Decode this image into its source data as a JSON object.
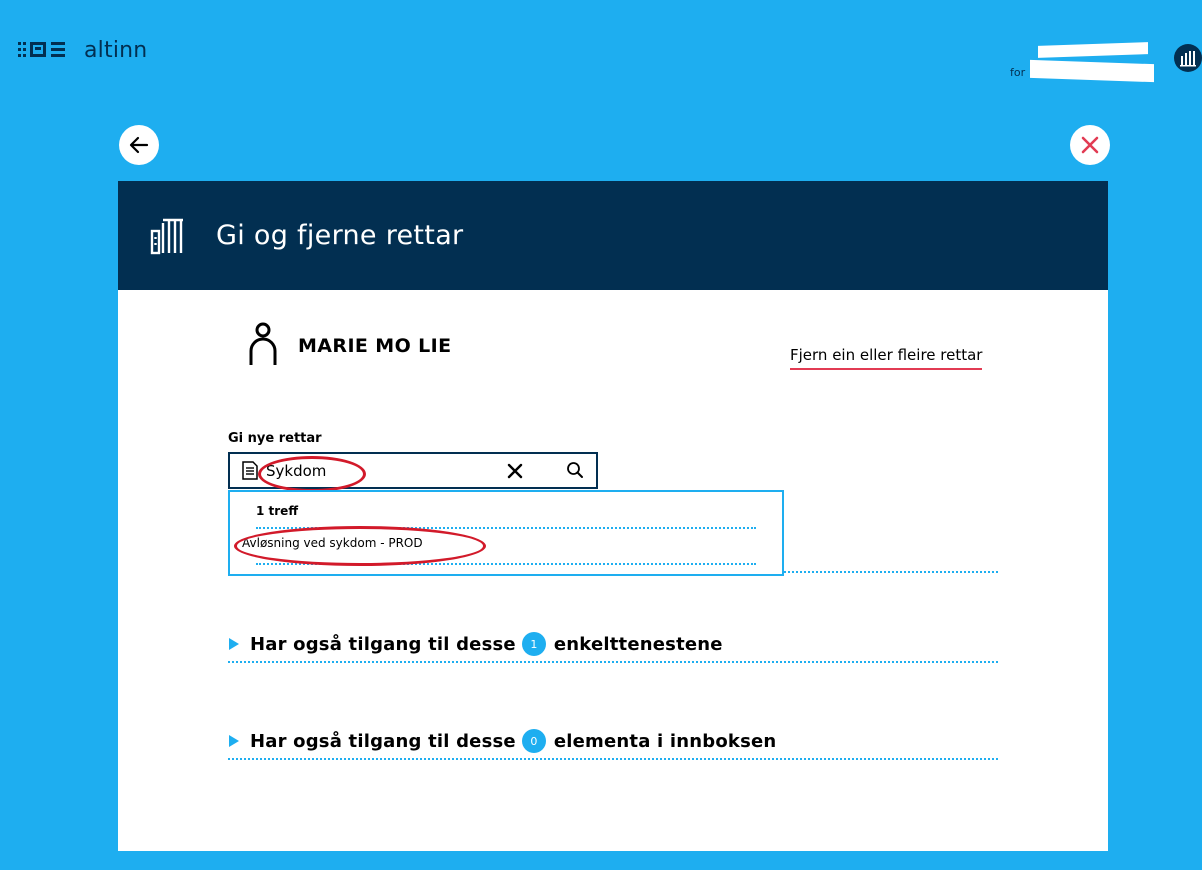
{
  "brand": {
    "logo_text": "altinn"
  },
  "user": {
    "for_label": "for"
  },
  "modal": {
    "title": "Gi og fjerne rettar"
  },
  "person": {
    "name": "MARIE MO LIE",
    "remove_rights_link": "Fjern ein eller fleire rettar"
  },
  "search": {
    "label": "Gi nye rettar",
    "value": "Sykdom",
    "hits_text": "1 treff",
    "results": [
      "Avløsning ved sykdom - PROD"
    ]
  },
  "expanders": [
    {
      "prefix": "Har også tilgang til desse",
      "count": "1",
      "suffix": "enkelttenestene"
    },
    {
      "prefix": "Har også tilgang til desse",
      "count": "0",
      "suffix": "elementa i innboksen"
    }
  ],
  "colors": {
    "background": "#1eaef0",
    "header": "#022f51",
    "close": "#e23b53",
    "annotation": "#d21a2a"
  },
  "icons": [
    "altinn-logo-icon",
    "organization-icon",
    "back-arrow-icon",
    "close-icon",
    "building-icon",
    "person-icon",
    "document-icon",
    "clear-x-icon",
    "search-icon",
    "caret-right-icon"
  ]
}
